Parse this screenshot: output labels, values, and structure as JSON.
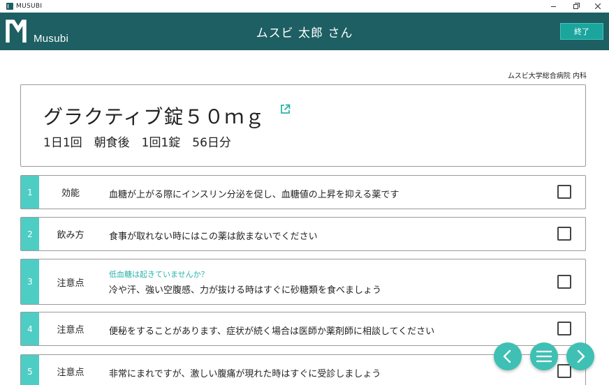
{
  "window": {
    "app_name": "MUSUBI",
    "icons": {
      "minimize": "minimize-icon",
      "maximize": "restore-icon",
      "close": "close-icon"
    }
  },
  "header": {
    "logo_text": "Musubi",
    "patient_name": "ムスビ 太郎 さん",
    "end_button": "終了",
    "colors": {
      "bar": "#1d5f63",
      "button": "#1aa59d"
    }
  },
  "hospital": "ムスビ大学総合病院 内科",
  "drug": {
    "name": "グラクティブ錠５０ｍｇ",
    "dosage": "1日1回　朝食後　1回1錠　56日分",
    "link_icon": "external-link-icon"
  },
  "items": [
    {
      "num": "1",
      "category": "効能",
      "text": "血糖が上がる際にインスリン分泌を促し、血糖値の上昇を抑える薬です",
      "sub": "",
      "checked": false
    },
    {
      "num": "2",
      "category": "飲み方",
      "text": "食事が取れない時にはこの薬は飲まないでください",
      "sub": "",
      "checked": false
    },
    {
      "num": "3",
      "category": "注意点",
      "text": "冷や汗、強い空腹感、力が抜ける時はすぐに砂糖類を食べましょう",
      "sub": "低血糖は起きていませんか？",
      "checked": false
    },
    {
      "num": "4",
      "category": "注意点",
      "text": "便秘をすることがあります、症状が続く場合は医師か薬剤師に相談してください",
      "sub": "",
      "checked": false
    },
    {
      "num": "5",
      "category": "注意点",
      "text": "非常にまれですが、激しい腹痛が現れた時はすぐに受診しましょう",
      "sub": "",
      "checked": false
    }
  ],
  "accent_color": "#4ecdc4",
  "nav": {
    "prev_icon": "chevron-left-icon",
    "menu_icon": "menu-icon",
    "next_icon": "chevron-right-icon"
  }
}
